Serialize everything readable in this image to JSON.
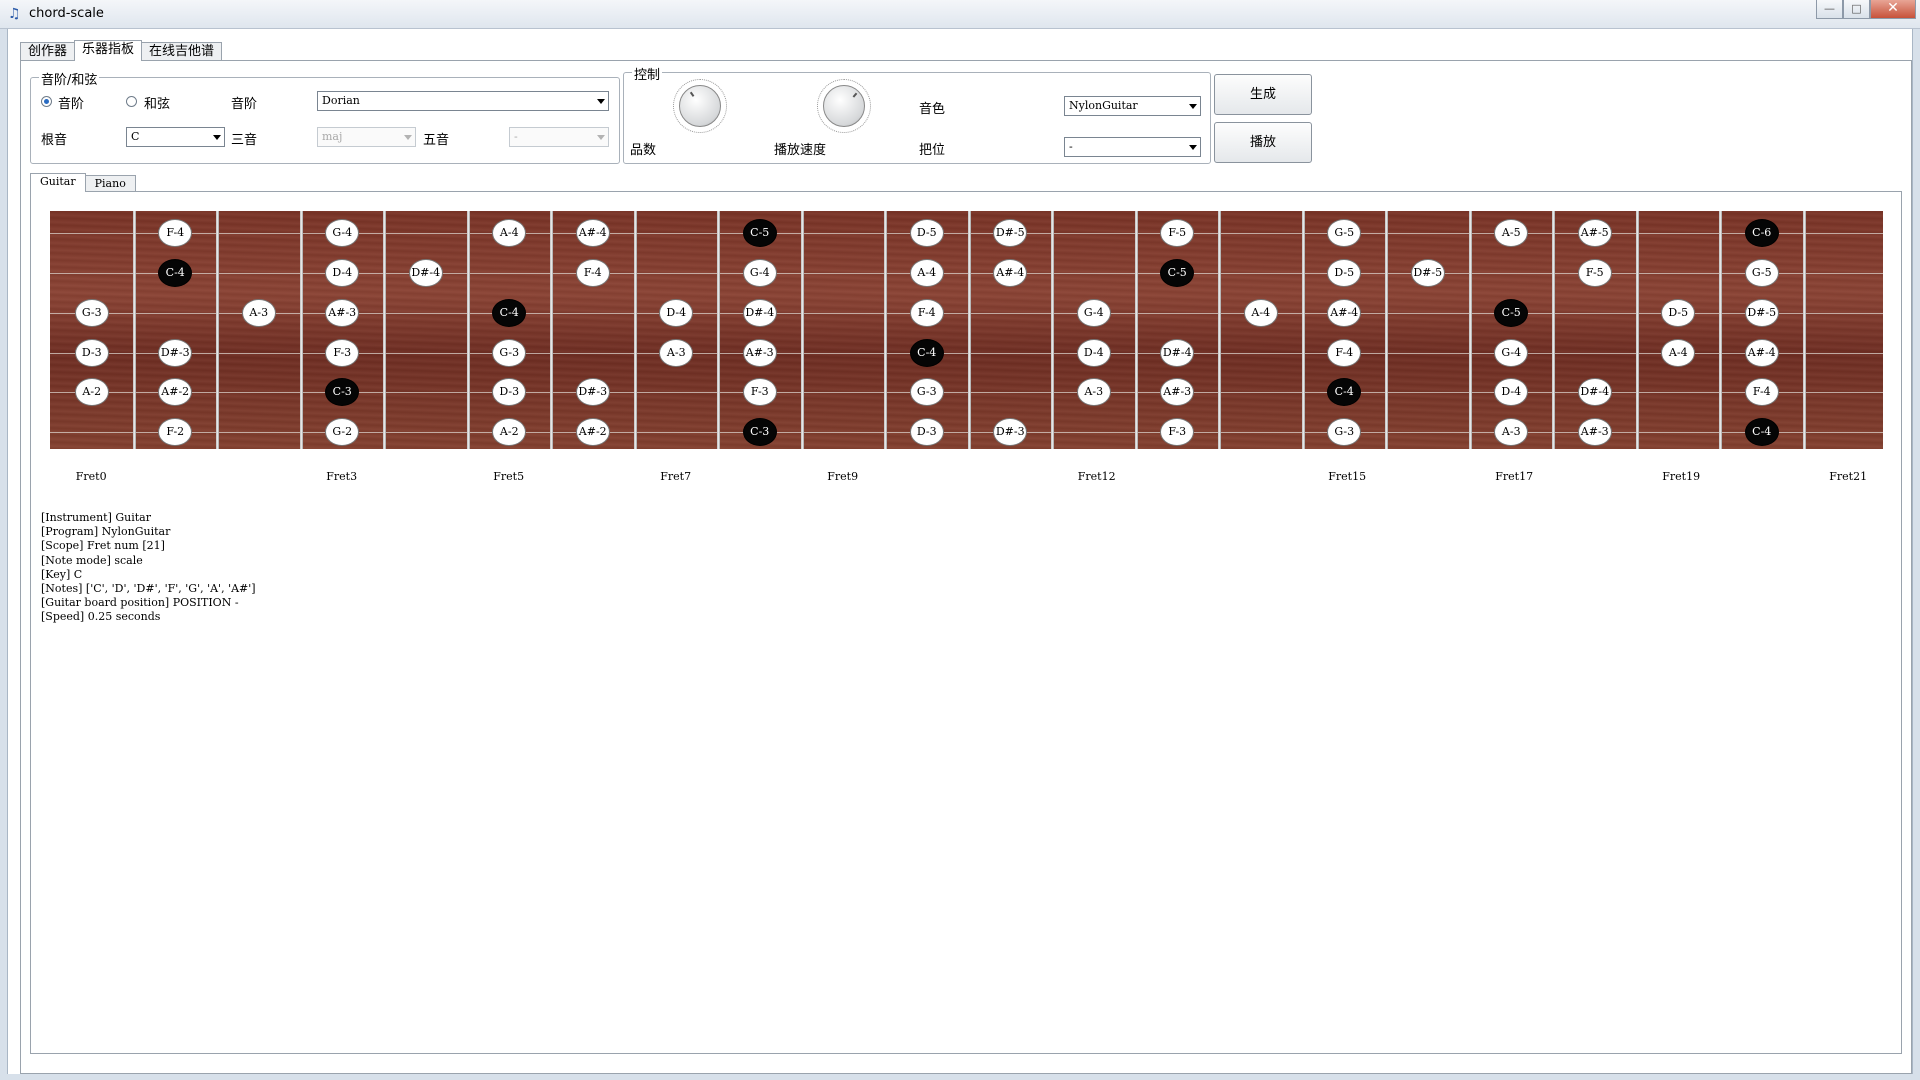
{
  "window": {
    "title": "chord-scale",
    "icon": "music-note-icon",
    "buttons": {
      "minimize": "—",
      "maximize": "□",
      "close": "✕"
    }
  },
  "main_tabs": [
    "创作器",
    "乐器指板",
    "在线吉他谱"
  ],
  "scale_group": {
    "title": "音阶/和弦",
    "radio_scale": "音阶",
    "radio_chord": "和弦",
    "scale_label": "音阶",
    "scale_value": "Dorian",
    "root_label": "根音",
    "root_value": "C",
    "third_label": "三音",
    "third_value": "maj",
    "fifth_label": "五音",
    "fifth_value": "-"
  },
  "control_group": {
    "title": "控制",
    "frets_label": "品数",
    "speed_label": "播放速度",
    "tone_label": "音色",
    "tone_value": "NylonGuitar",
    "position_label": "把位",
    "position_value": "-"
  },
  "buttons": {
    "generate": "生成",
    "play": "播放"
  },
  "sub_tabs": [
    "Guitar",
    "Piano"
  ],
  "fretboard": {
    "string_count": 6,
    "fret_count": 22,
    "fret_labels": [
      {
        "fret": 0,
        "label": "Fret0"
      },
      {
        "fret": 3,
        "label": "Fret3"
      },
      {
        "fret": 5,
        "label": "Fret5"
      },
      {
        "fret": 7,
        "label": "Fret7"
      },
      {
        "fret": 9,
        "label": "Fret9"
      },
      {
        "fret": 12,
        "label": "Fret12"
      },
      {
        "fret": 15,
        "label": "Fret15"
      },
      {
        "fret": 17,
        "label": "Fret17"
      },
      {
        "fret": 19,
        "label": "Fret19"
      },
      {
        "fret": 21,
        "label": "Fret21"
      }
    ],
    "notes": [
      {
        "string": 1,
        "fret": 1,
        "label": "F-4"
      },
      {
        "string": 1,
        "fret": 3,
        "label": "G-4"
      },
      {
        "string": 1,
        "fret": 5,
        "label": "A-4"
      },
      {
        "string": 1,
        "fret": 6,
        "label": "A#-4"
      },
      {
        "string": 1,
        "fret": 8,
        "label": "C-5",
        "root": true
      },
      {
        "string": 1,
        "fret": 10,
        "label": "D-5"
      },
      {
        "string": 1,
        "fret": 11,
        "label": "D#-5"
      },
      {
        "string": 1,
        "fret": 13,
        "label": "F-5"
      },
      {
        "string": 1,
        "fret": 15,
        "label": "G-5"
      },
      {
        "string": 1,
        "fret": 17,
        "label": "A-5"
      },
      {
        "string": 1,
        "fret": 18,
        "label": "A#-5"
      },
      {
        "string": 1,
        "fret": 20,
        "label": "C-6",
        "root": true
      },
      {
        "string": 2,
        "fret": 1,
        "label": "C-4",
        "root": true
      },
      {
        "string": 2,
        "fret": 3,
        "label": "D-4"
      },
      {
        "string": 2,
        "fret": 4,
        "label": "D#-4"
      },
      {
        "string": 2,
        "fret": 6,
        "label": "F-4"
      },
      {
        "string": 2,
        "fret": 8,
        "label": "G-4"
      },
      {
        "string": 2,
        "fret": 10,
        "label": "A-4"
      },
      {
        "string": 2,
        "fret": 11,
        "label": "A#-4"
      },
      {
        "string": 2,
        "fret": 13,
        "label": "C-5",
        "root": true
      },
      {
        "string": 2,
        "fret": 15,
        "label": "D-5"
      },
      {
        "string": 2,
        "fret": 16,
        "label": "D#-5"
      },
      {
        "string": 2,
        "fret": 18,
        "label": "F-5"
      },
      {
        "string": 2,
        "fret": 20,
        "label": "G-5"
      },
      {
        "string": 3,
        "fret": 0,
        "label": "G-3"
      },
      {
        "string": 3,
        "fret": 2,
        "label": "A-3"
      },
      {
        "string": 3,
        "fret": 3,
        "label": "A#-3"
      },
      {
        "string": 3,
        "fret": 5,
        "label": "C-4",
        "root": true
      },
      {
        "string": 3,
        "fret": 7,
        "label": "D-4"
      },
      {
        "string": 3,
        "fret": 8,
        "label": "D#-4"
      },
      {
        "string": 3,
        "fret": 10,
        "label": "F-4"
      },
      {
        "string": 3,
        "fret": 12,
        "label": "G-4"
      },
      {
        "string": 3,
        "fret": 14,
        "label": "A-4"
      },
      {
        "string": 3,
        "fret": 15,
        "label": "A#-4"
      },
      {
        "string": 3,
        "fret": 17,
        "label": "C-5",
        "root": true
      },
      {
        "string": 3,
        "fret": 19,
        "label": "D-5"
      },
      {
        "string": 3,
        "fret": 20,
        "label": "D#-5"
      },
      {
        "string": 4,
        "fret": 0,
        "label": "D-3"
      },
      {
        "string": 4,
        "fret": 1,
        "label": "D#-3"
      },
      {
        "string": 4,
        "fret": 3,
        "label": "F-3"
      },
      {
        "string": 4,
        "fret": 5,
        "label": "G-3"
      },
      {
        "string": 4,
        "fret": 7,
        "label": "A-3"
      },
      {
        "string": 4,
        "fret": 8,
        "label": "A#-3"
      },
      {
        "string": 4,
        "fret": 10,
        "label": "C-4",
        "root": true
      },
      {
        "string": 4,
        "fret": 12,
        "label": "D-4"
      },
      {
        "string": 4,
        "fret": 13,
        "label": "D#-4"
      },
      {
        "string": 4,
        "fret": 15,
        "label": "F-4"
      },
      {
        "string": 4,
        "fret": 17,
        "label": "G-4"
      },
      {
        "string": 4,
        "fret": 19,
        "label": "A-4"
      },
      {
        "string": 4,
        "fret": 20,
        "label": "A#-4"
      },
      {
        "string": 5,
        "fret": 0,
        "label": "A-2"
      },
      {
        "string": 5,
        "fret": 1,
        "label": "A#-2"
      },
      {
        "string": 5,
        "fret": 3,
        "label": "C-3",
        "root": true
      },
      {
        "string": 5,
        "fret": 5,
        "label": "D-3"
      },
      {
        "string": 5,
        "fret": 6,
        "label": "D#-3"
      },
      {
        "string": 5,
        "fret": 8,
        "label": "F-3"
      },
      {
        "string": 5,
        "fret": 10,
        "label": "G-3"
      },
      {
        "string": 5,
        "fret": 12,
        "label": "A-3"
      },
      {
        "string": 5,
        "fret": 13,
        "label": "A#-3"
      },
      {
        "string": 5,
        "fret": 15,
        "label": "C-4",
        "root": true
      },
      {
        "string": 5,
        "fret": 17,
        "label": "D-4"
      },
      {
        "string": 5,
        "fret": 18,
        "label": "D#-4"
      },
      {
        "string": 5,
        "fret": 20,
        "label": "F-4"
      },
      {
        "string": 6,
        "fret": 1,
        "label": "F-2"
      },
      {
        "string": 6,
        "fret": 3,
        "label": "G-2"
      },
      {
        "string": 6,
        "fret": 5,
        "label": "A-2"
      },
      {
        "string": 6,
        "fret": 6,
        "label": "A#-2"
      },
      {
        "string": 6,
        "fret": 8,
        "label": "C-3",
        "root": true
      },
      {
        "string": 6,
        "fret": 10,
        "label": "D-3"
      },
      {
        "string": 6,
        "fret": 11,
        "label": "D#-3"
      },
      {
        "string": 6,
        "fret": 13,
        "label": "F-3"
      },
      {
        "string": 6,
        "fret": 15,
        "label": "G-3"
      },
      {
        "string": 6,
        "fret": 17,
        "label": "A-3"
      },
      {
        "string": 6,
        "fret": 18,
        "label": "A#-3"
      },
      {
        "string": 6,
        "fret": 20,
        "label": "C-4",
        "root": true
      }
    ]
  },
  "info_lines": [
    "[Instrument] Guitar",
    "[Program] NylonGuitar",
    "[Scope] Fret num [21]",
    "[Note mode] scale",
    "[Key] C",
    "[Notes] ['C', 'D', 'D#', 'F', 'G', 'A', 'A#']",
    "[Guitar board position] POSITION -",
    "[Speed] 0.25 seconds"
  ],
  "colors": {
    "root_note": "#050505",
    "note": "#ffffff",
    "fretboard_wood": "#7a3326"
  }
}
